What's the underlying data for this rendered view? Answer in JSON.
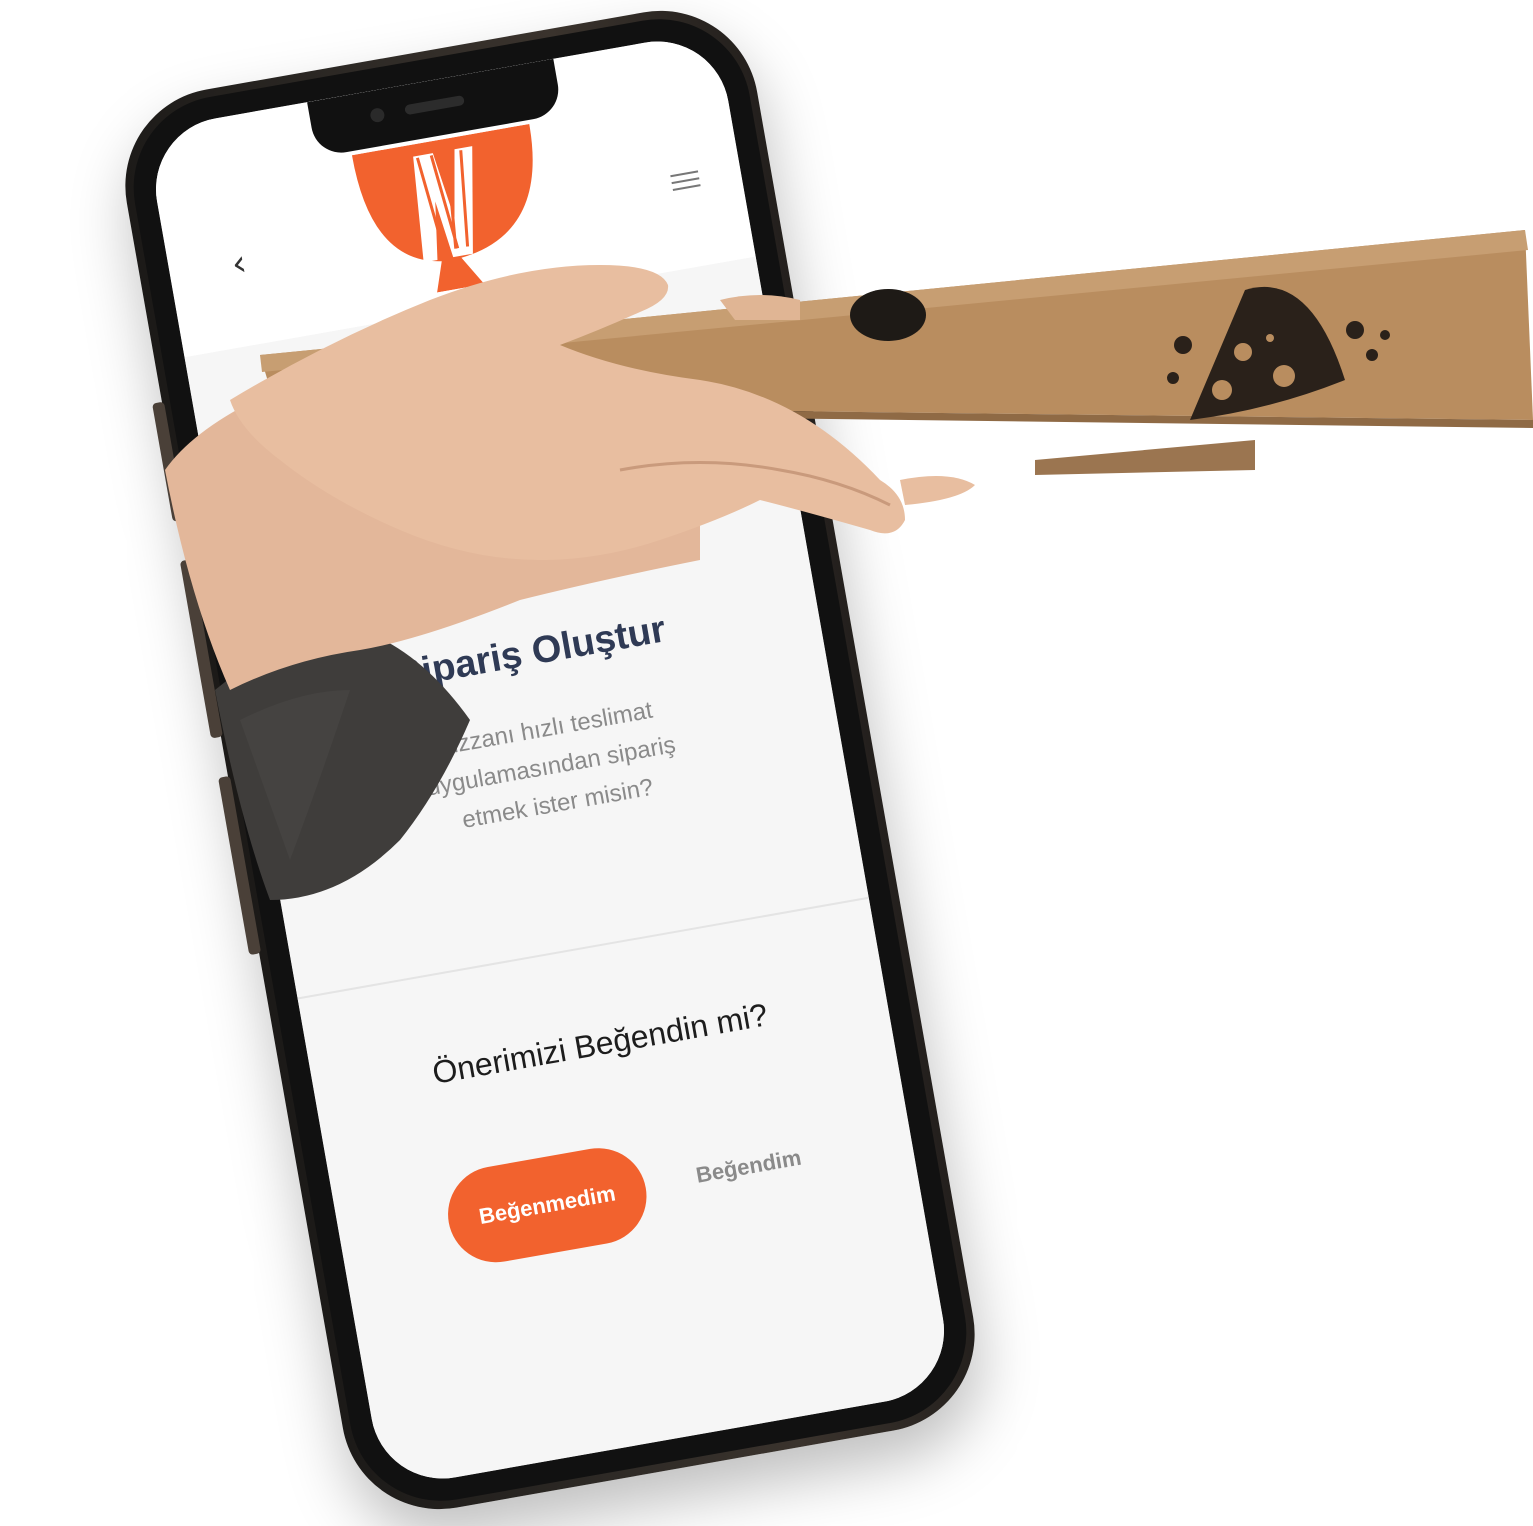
{
  "app": {
    "title": "Sipariş Oluştur",
    "description": "Pizzanı hızlı teslimat uygulamasından sipariş etmek ister misin?",
    "question": "Önerimizi Beğendin mi?",
    "buttons": {
      "dislike": "Beğenmedim",
      "like": "Beğendim"
    }
  },
  "icons": {
    "back": "chevron-left-icon",
    "menu": "hamburger-menu-icon",
    "logo": "brand-logo",
    "pizza": "pizza-slice-icon"
  },
  "colors": {
    "accent": "#f2622e",
    "title": "#2f3a55",
    "muted": "#8a8a8a",
    "cardboard": "#b98d5f"
  }
}
